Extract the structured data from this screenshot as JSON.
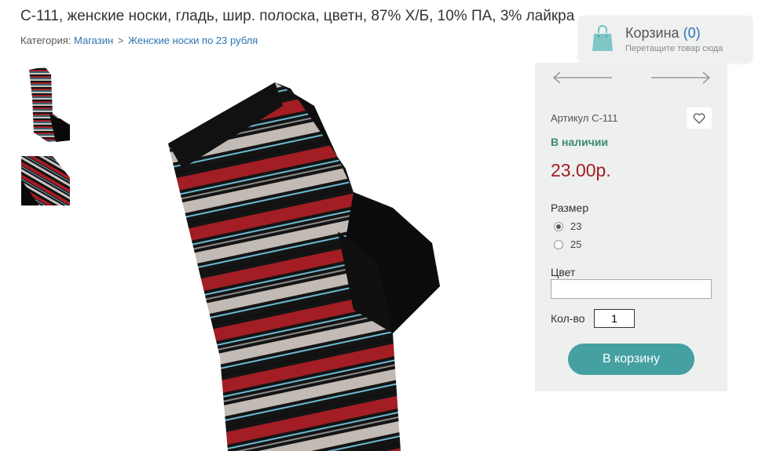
{
  "product": {
    "title": "С-111, женские носки, гладь, шир. полоска, цветн, 87% Х/Б, 10% ПА, 3% лайкра"
  },
  "breadcrumb": {
    "prefix": "Категория:",
    "items": [
      "Магазин",
      "Женские носки по 23 рубля"
    ],
    "separator": ">"
  },
  "cart": {
    "title": "Корзина",
    "count": "(0)",
    "hint": "Перетащите товар сюда"
  },
  "buy_panel": {
    "sku": "Артикул С-111",
    "stock": "В наличии",
    "price": "23.00р.",
    "size_label": "Размер",
    "sizes": [
      {
        "label": "23",
        "selected": true
      },
      {
        "label": "25",
        "selected": false
      }
    ],
    "color_label": "Цвет",
    "color_value": "",
    "qty_label": "Кол-во",
    "qty_value": "1",
    "add_label": "В корзину"
  },
  "icons": {
    "cart": "shopping-bag-icon",
    "wish": "heart-icon",
    "prev": "arrow-left-icon",
    "next": "arrow-right-icon"
  },
  "colors": {
    "accent": "#45a0a2",
    "price": "#a31d24",
    "stock": "#3a8a6e",
    "link": "#2c74b3",
    "panel": "#eeefef"
  }
}
